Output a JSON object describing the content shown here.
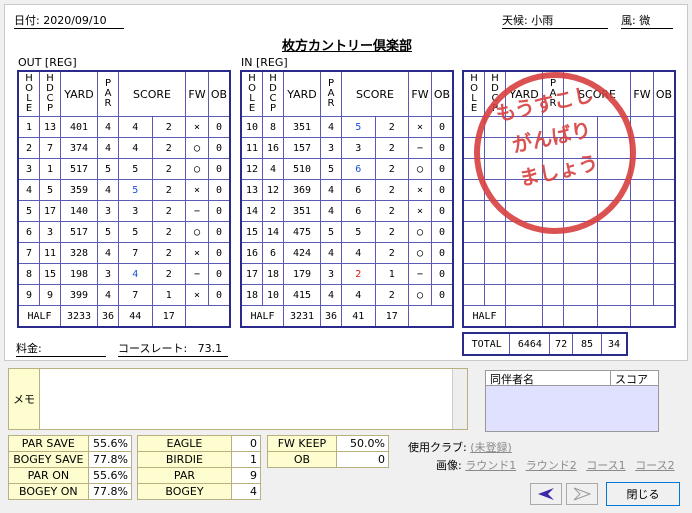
{
  "header": {
    "date": "日付: 2020/09/10",
    "weather": "天候: 小雨",
    "wind": "風: 微"
  },
  "title": "枚方カントリー倶楽部",
  "out_label": "OUT [REG]",
  "in_label": "IN [REG]",
  "columns": {
    "hole": "HOLE",
    "hdcp": "HDCP",
    "yard": "YARD",
    "par": "PAR",
    "score": "SCORE",
    "fw": "FW",
    "ob": "OB"
  },
  "out_rows": [
    {
      "hole": "1",
      "hdcp": "13",
      "yard": "401",
      "par": "4",
      "score": "4",
      "putt": "2",
      "fw": "×",
      "ob": "0",
      "style": ""
    },
    {
      "hole": "2",
      "hdcp": "7",
      "yard": "374",
      "par": "4",
      "score": "4",
      "putt": "2",
      "fw": "◯",
      "ob": "0",
      "style": ""
    },
    {
      "hole": "3",
      "hdcp": "1",
      "yard": "517",
      "par": "5",
      "score": "5",
      "putt": "2",
      "fw": "◯",
      "ob": "0",
      "style": ""
    },
    {
      "hole": "4",
      "hdcp": "5",
      "yard": "359",
      "par": "4",
      "score": "5",
      "putt": "2",
      "fw": "×",
      "ob": "0",
      "style": "blue"
    },
    {
      "hole": "5",
      "hdcp": "17",
      "yard": "140",
      "par": "3",
      "score": "3",
      "putt": "2",
      "fw": "−",
      "ob": "0",
      "style": ""
    },
    {
      "hole": "6",
      "hdcp": "3",
      "yard": "517",
      "par": "5",
      "score": "5",
      "putt": "2",
      "fw": "◯",
      "ob": "0",
      "style": ""
    },
    {
      "hole": "7",
      "hdcp": "11",
      "yard": "328",
      "par": "4",
      "score": "7",
      "putt": "2",
      "fw": "×",
      "ob": "0",
      "style": "bold"
    },
    {
      "hole": "8",
      "hdcp": "15",
      "yard": "198",
      "par": "3",
      "score": "4",
      "putt": "2",
      "fw": "−",
      "ob": "0",
      "style": "blue"
    },
    {
      "hole": "9",
      "hdcp": "9",
      "yard": "399",
      "par": "4",
      "score": "7",
      "putt": "1",
      "fw": "×",
      "ob": "0",
      "style": "bold"
    }
  ],
  "out_half": {
    "label": "HALF",
    "yard": "3233",
    "par": "36",
    "score": "44",
    "putt": "17"
  },
  "in_rows": [
    {
      "hole": "10",
      "hdcp": "8",
      "yard": "351",
      "par": "4",
      "score": "5",
      "putt": "2",
      "fw": "×",
      "ob": "0",
      "style": "blue"
    },
    {
      "hole": "11",
      "hdcp": "16",
      "yard": "157",
      "par": "3",
      "score": "3",
      "putt": "2",
      "fw": "−",
      "ob": "0",
      "style": ""
    },
    {
      "hole": "12",
      "hdcp": "4",
      "yard": "510",
      "par": "5",
      "score": "6",
      "putt": "2",
      "fw": "◯",
      "ob": "0",
      "style": "blue"
    },
    {
      "hole": "13",
      "hdcp": "12",
      "yard": "369",
      "par": "4",
      "score": "6",
      "putt": "2",
      "fw": "×",
      "ob": "0",
      "style": "bold"
    },
    {
      "hole": "14",
      "hdcp": "2",
      "yard": "351",
      "par": "4",
      "score": "6",
      "putt": "2",
      "fw": "×",
      "ob": "0",
      "style": "bold"
    },
    {
      "hole": "15",
      "hdcp": "14",
      "yard": "475",
      "par": "5",
      "score": "5",
      "putt": "2",
      "fw": "◯",
      "ob": "0",
      "style": ""
    },
    {
      "hole": "16",
      "hdcp": "6",
      "yard": "424",
      "par": "4",
      "score": "4",
      "putt": "2",
      "fw": "◯",
      "ob": "0",
      "style": ""
    },
    {
      "hole": "17",
      "hdcp": "18",
      "yard": "179",
      "par": "3",
      "score": "2",
      "putt": "1",
      "fw": "−",
      "ob": "0",
      "style": "red"
    },
    {
      "hole": "18",
      "hdcp": "10",
      "yard": "415",
      "par": "4",
      "score": "4",
      "putt": "2",
      "fw": "◯",
      "ob": "0",
      "style": ""
    }
  ],
  "in_half": {
    "label": "HALF",
    "yard": "3231",
    "par": "36",
    "score": "41",
    "putt": "17"
  },
  "third_half_label": "HALF",
  "total": {
    "label": "TOTAL",
    "yard": "6464",
    "par": "72",
    "score": "85",
    "putt": "34"
  },
  "stamp": [
    "もうすこし",
    "がんばり",
    "ましょう"
  ],
  "fee_label": "料金:",
  "course_rate_label": "コースレート:",
  "course_rate_value": "73.1",
  "memo_label": "メモ",
  "companion": {
    "name_header": "同伴者名",
    "score_header": "スコア"
  },
  "stats1": [
    {
      "label": "PAR SAVE",
      "value": "55.6%"
    },
    {
      "label": "BOGEY SAVE",
      "value": "77.8%"
    },
    {
      "label": "PAR ON",
      "value": "55.6%"
    },
    {
      "label": "BOGEY ON",
      "value": "77.8%"
    }
  ],
  "stats2": [
    {
      "label": "EAGLE",
      "value": "0"
    },
    {
      "label": "BIRDIE",
      "value": "1"
    },
    {
      "label": "PAR",
      "value": "9"
    },
    {
      "label": "BOGEY",
      "value": "4"
    }
  ],
  "stats3": [
    {
      "label": "FW KEEP",
      "value": "50.0%"
    },
    {
      "label": "OB",
      "value": "0"
    }
  ],
  "club_label": "使用クラブ:",
  "club_link": "(未登録)",
  "image_label": "画像:",
  "image_links": [
    "ラウンド1",
    "ラウンド2",
    "コース1",
    "コース2"
  ],
  "close_label": "閉じる",
  "colors": {
    "grid": "#2a2a8a",
    "accent": "#1a4fd8",
    "stamp": "#d84040"
  }
}
